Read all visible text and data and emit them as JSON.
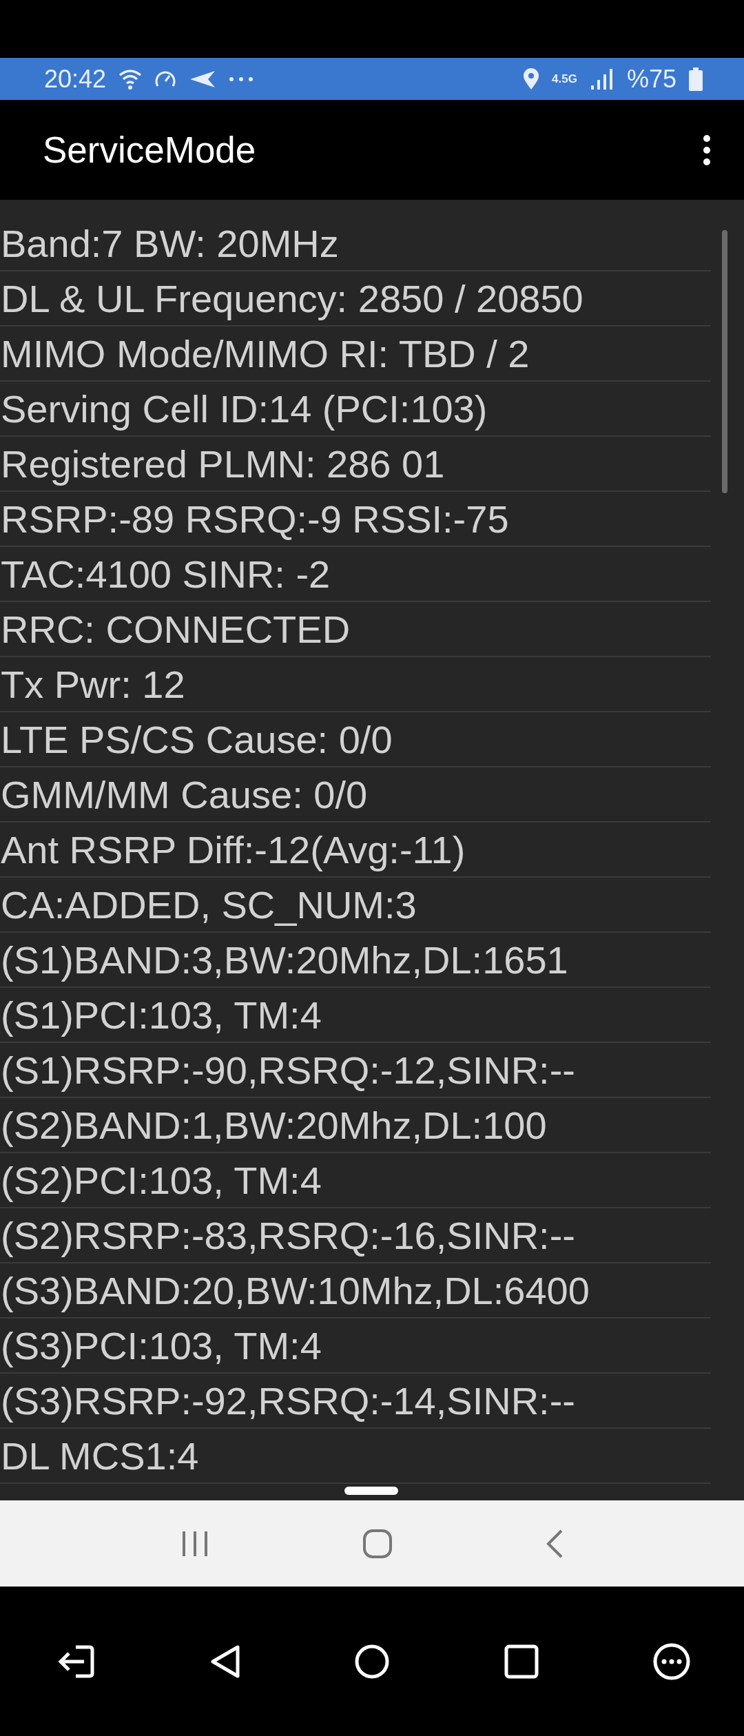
{
  "status_bar": {
    "time": "20:42",
    "network": "4.5G",
    "battery": "%75"
  },
  "app_bar": {
    "title": "ServiceMode"
  },
  "rows": [
    "Band:7 BW: 20MHz",
    "DL & UL Frequency: 2850 / 20850",
    "MIMO Mode/MIMO RI: TBD / 2",
    "Serving Cell ID:14 (PCI:103)",
    "Registered PLMN: 286 01",
    "RSRP:-89 RSRQ:-9 RSSI:-75",
    "TAC:4100 SINR: -2",
    "RRC: CONNECTED",
    "Tx Pwr: 12",
    "LTE PS/CS Cause: 0/0",
    "GMM/MM Cause: 0/0",
    "Ant RSRP Diff:-12(Avg:-11)",
    "CA:ADDED, SC_NUM:3",
    "(S1)BAND:3,BW:20Mhz,DL:1651",
    "(S1)PCI:103, TM:4",
    "(S1)RSRP:-90,RSRQ:-12,SINR:--",
    "(S2)BAND:1,BW:20Mhz,DL:100",
    "(S2)PCI:103, TM:4",
    "(S2)RSRP:-83,RSRQ:-16,SINR:--",
    "(S3)BAND:20,BW:10Mhz,DL:6400",
    "(S3)PCI:103, TM:4",
    "(S3)RSRP:-92,RSRQ:-14,SINR:--",
    "DL MCS1:4"
  ]
}
